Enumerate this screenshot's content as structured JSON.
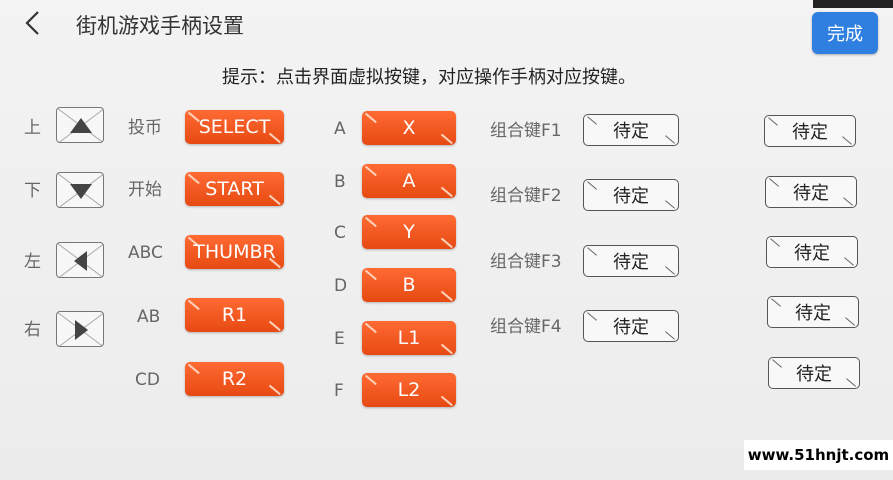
{
  "header": {
    "title": "街机游戏手柄设置",
    "done_label": "完成",
    "hint": "提示：点击界面虚拟按键，对应操作手柄对应按键。"
  },
  "dpad": [
    {
      "label": "上",
      "icon": "arrow-up-icon"
    },
    {
      "label": "下",
      "icon": "arrow-down-icon"
    },
    {
      "label": "左",
      "icon": "arrow-left-icon"
    },
    {
      "label": "右",
      "icon": "arrow-right-icon"
    }
  ],
  "functions": [
    {
      "label": "投币",
      "button": "SELECT"
    },
    {
      "label": "开始",
      "button": "START"
    },
    {
      "label": "ABC",
      "button": "THUMBR"
    },
    {
      "label": "AB",
      "button": "R1"
    },
    {
      "label": "CD",
      "button": "R2"
    }
  ],
  "letters": [
    {
      "label": "A",
      "button": "X"
    },
    {
      "label": "B",
      "button": "A"
    },
    {
      "label": "C",
      "button": "Y"
    },
    {
      "label": "D",
      "button": "B"
    },
    {
      "label": "E",
      "button": "L1"
    },
    {
      "label": "F",
      "button": "L2"
    }
  ],
  "combos": [
    {
      "label": "组合键F1",
      "button": "待定"
    },
    {
      "label": "组合键F2",
      "button": "待定"
    },
    {
      "label": "组合键F3",
      "button": "待定"
    },
    {
      "label": "组合键F4",
      "button": "待定"
    }
  ],
  "extra_buttons": [
    "待定",
    "待定",
    "待定",
    "待定",
    "待定"
  ],
  "watermark": "www.51hnjt.com",
  "colors": {
    "accent": "#2f7fe0",
    "button": "#e64a12"
  }
}
